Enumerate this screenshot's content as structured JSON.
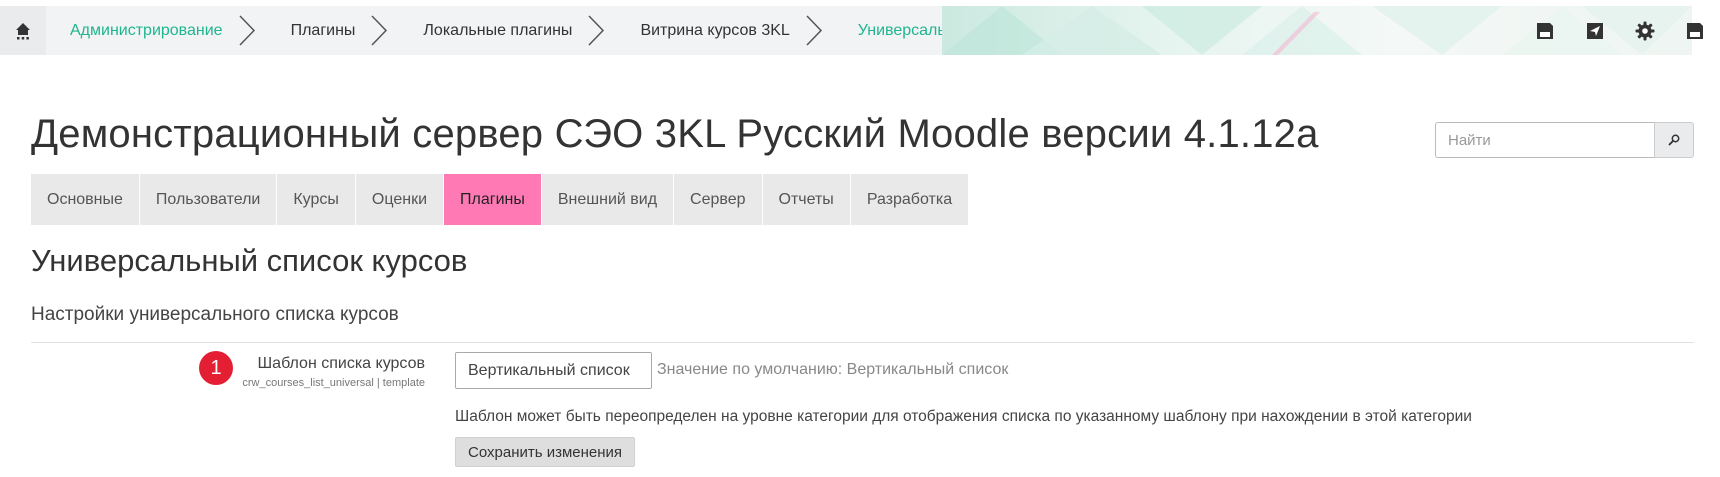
{
  "breadcrumb": {
    "items": [
      {
        "label": "Администрирование",
        "style": "link"
      },
      {
        "label": "Плагины",
        "style": "plain"
      },
      {
        "label": "Локальные плагины",
        "style": "plain"
      },
      {
        "label": "Витрина курсов 3KL",
        "style": "plain"
      },
      {
        "label": "Универсальный список курсов",
        "style": "link"
      }
    ]
  },
  "topbar": {
    "icons": [
      "home-icon",
      "save-icon",
      "send-icon",
      "gear-icon",
      "save-icon"
    ]
  },
  "header": {
    "title": "Демонстрационный сервер СЭО 3KL Русский Moodle версии 4.1.12а",
    "search_placeholder": "Найти"
  },
  "tabs": [
    {
      "label": "Основные",
      "active": false
    },
    {
      "label": "Пользователи",
      "active": false
    },
    {
      "label": "Курсы",
      "active": false
    },
    {
      "label": "Оценки",
      "active": false
    },
    {
      "label": "Плагины",
      "active": true
    },
    {
      "label": "Внешний вид",
      "active": false
    },
    {
      "label": "Сервер",
      "active": false
    },
    {
      "label": "Отчеты",
      "active": false
    },
    {
      "label": "Разработка",
      "active": false
    }
  ],
  "page": {
    "heading": "Универсальный список курсов",
    "section_heading": "Настройки универсального списка курсов",
    "setting": {
      "badge": "1",
      "label": "Шаблон списка курсов",
      "key": "crw_courses_list_universal | template",
      "selected": "Вертикальный список",
      "default": "Значение по умолчанию: Вертикальный список",
      "description": "Шаблон может быть переопределен на уровне категории для отображения списка по указанному шаблону при нахождении в этой категории"
    },
    "save_label": "Сохранить изменения"
  },
  "colors": {
    "link": "#1fb58f",
    "active_tab": "#ff7ab5",
    "badge": "#e41e33"
  }
}
